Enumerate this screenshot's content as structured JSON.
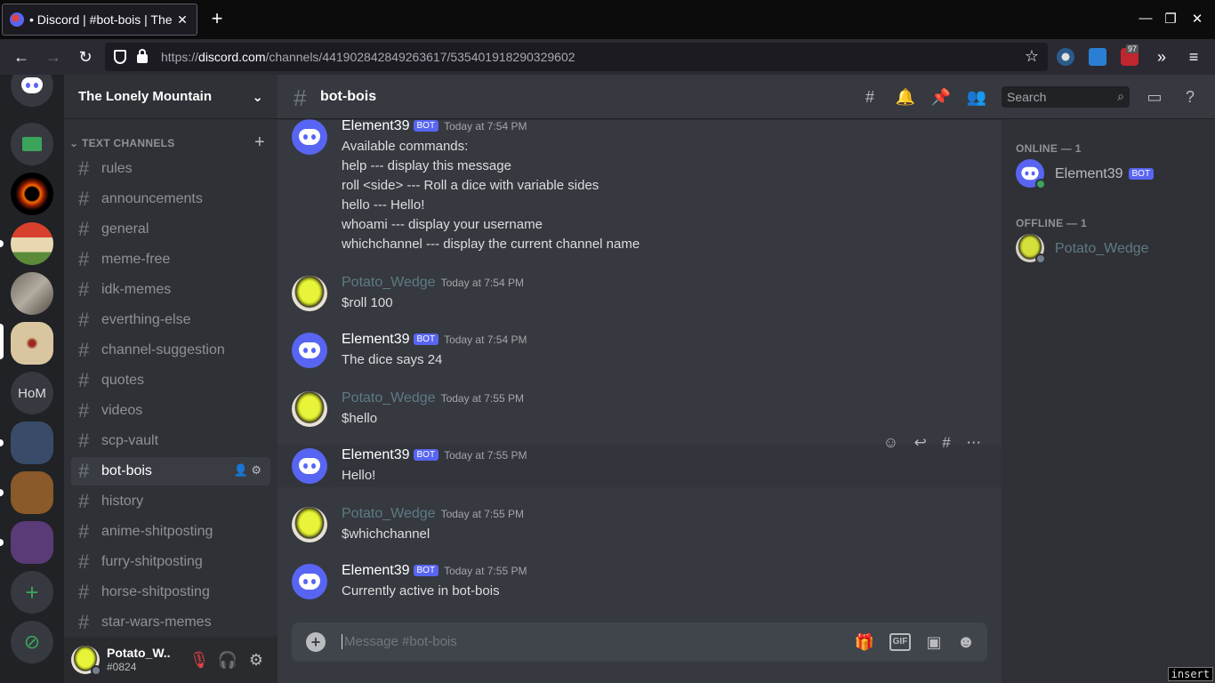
{
  "browser": {
    "tab_title": "• Discord | #bot-bois | The Lonely Mountain",
    "tab_close": "✕",
    "newtab": "+",
    "url_domain": "discord.com",
    "url_prefix": "https://",
    "url_path": "/channels/441902842849263617/535401918290329602",
    "ext_badge": "97",
    "controls": {
      "minimize": "—",
      "restore": "❐",
      "close": "✕"
    }
  },
  "servers": {
    "folder_label": "HoM"
  },
  "guild": {
    "name": "The Lonely Mountain",
    "category": "TEXT CHANNELS",
    "channels": [
      {
        "name": "rules"
      },
      {
        "name": "announcements"
      },
      {
        "name": "general"
      },
      {
        "name": "meme-free"
      },
      {
        "name": "idk-memes"
      },
      {
        "name": "everthing-else"
      },
      {
        "name": "channel-suggestion"
      },
      {
        "name": "quotes"
      },
      {
        "name": "videos"
      },
      {
        "name": "scp-vault"
      },
      {
        "name": "bot-bois"
      },
      {
        "name": "history"
      },
      {
        "name": "anime-shitposting"
      },
      {
        "name": "furry-shitposting"
      },
      {
        "name": "horse-shitposting"
      },
      {
        "name": "star-wars-memes"
      }
    ]
  },
  "user": {
    "name": "Potato_W...",
    "tag": "#0824"
  },
  "channel": {
    "name": "bot-bois",
    "search_placeholder": "Search"
  },
  "messages": [
    {
      "author": "Element39",
      "bot": "BOT",
      "time": "Today at 7:54 PM",
      "lines": [
        "Available commands:",
        "help --- display this message",
        "roll <side> --- Roll a dice with variable sides",
        "hello --- Hello!",
        "whoami --- display your username",
        "whichchannel --- display the current channel name"
      ]
    },
    {
      "author": "Potato_Wedge",
      "time": "Today at 7:54 PM",
      "lines": [
        "$roll 100"
      ]
    },
    {
      "author": "Element39",
      "bot": "BOT",
      "time": "Today at 7:54 PM",
      "lines": [
        "The dice says 24"
      ]
    },
    {
      "author": "Potato_Wedge",
      "time": "Today at 7:55 PM",
      "lines": [
        "$hello"
      ]
    },
    {
      "author": "Element39",
      "bot": "BOT",
      "time": "Today at 7:55 PM",
      "lines": [
        "Hello!"
      ]
    },
    {
      "author": "Potato_Wedge",
      "time": "Today at 7:55 PM",
      "lines": [
        "$whichchannel"
      ]
    },
    {
      "author": "Element39",
      "bot": "BOT",
      "time": "Today at 7:55 PM",
      "lines": [
        "Currently active in bot-bois"
      ]
    }
  ],
  "composer": {
    "placeholder": "Message #bot-bois",
    "gif": "GIF"
  },
  "members": {
    "online_header": "ONLINE — 1",
    "offline_header": "OFFLINE — 1",
    "online": [
      {
        "name": "Element39",
        "bot": "BOT"
      }
    ],
    "offline": [
      {
        "name": "Potato_Wedge"
      }
    ]
  },
  "statusbar": {
    "mode": "insert"
  },
  "colors": {
    "blurple": "#5865f2",
    "online": "#3ba55d",
    "offline": "#747f8d"
  }
}
